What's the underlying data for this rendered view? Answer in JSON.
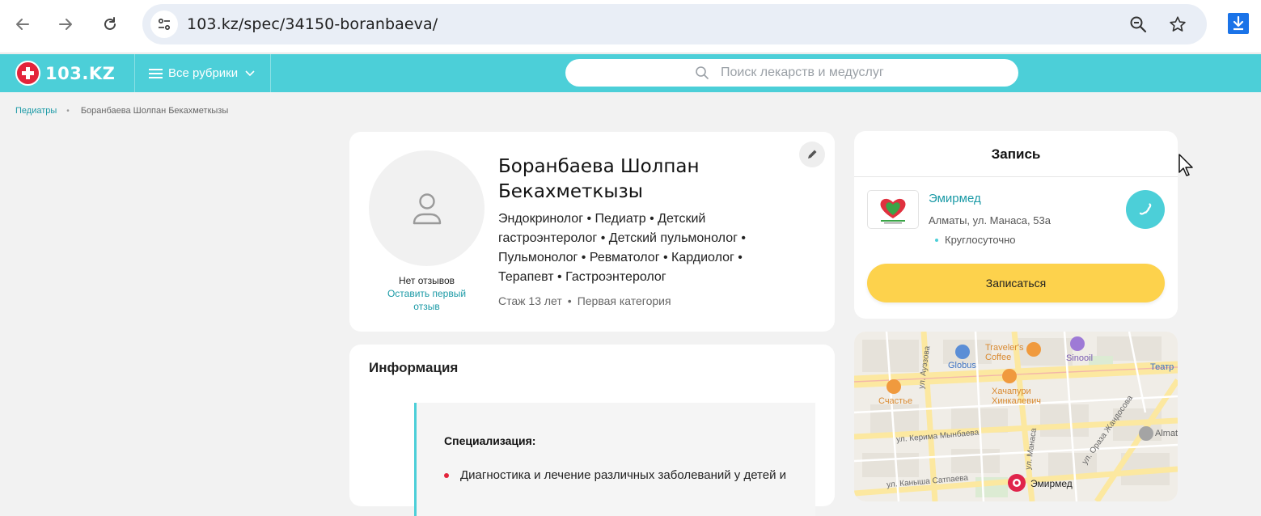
{
  "browser": {
    "url": "103.kz/spec/34150-boranbaeva/",
    "icons": [
      "back-arrow-icon",
      "forward-arrow-icon",
      "reload-icon",
      "site-settings-icon",
      "zoom-icon",
      "bookmark-star-icon",
      "download-icon"
    ]
  },
  "header": {
    "logo_text": "103.KZ",
    "rubrics_label": "Все рубрики",
    "search_placeholder": "Поиск лекарств и медуслуг",
    "brand_color": "#4ccfd8",
    "logo_color": "#e3243b"
  },
  "breadcrumb": {
    "items": [
      {
        "label": "Педиатры"
      },
      {
        "label": "Боранбаева Шолпан Бекахметкызы"
      }
    ],
    "separator": "•"
  },
  "profile": {
    "name": "Боранбаева Шолпан Бекахметкызы",
    "specialties": "Эндокринолог • Педиатр • Детский гастроэнтеролог • Детский пульмонолог • Пульмонолог • Ревматолог • Кардиолог • Терапевт • Гастроэнтеролог",
    "experience": "Стаж 13 лет",
    "category": "Первая категория",
    "no_reviews": "Нет отзывов",
    "leave_review": "Оставить первый отзыв"
  },
  "info": {
    "title": "Информация",
    "specialization_title": "Специализация:",
    "items": [
      "Диагностика и лечение различных заболеваний у детей и"
    ]
  },
  "booking": {
    "title": "Запись",
    "clinic_name": "Эмирмед",
    "clinic_address": "Алматы, ул. Манаса, 53а",
    "clinic_hours": "Круглосуточно",
    "book_button": "Записаться",
    "button_color": "#fdd24c"
  },
  "map": {
    "labels": {
      "travelers": "Traveler's\nCoffee",
      "sinooil": "Sinooil",
      "globus": "Globus",
      "teatr": "Театр",
      "khachapuri": "Хачапури\nХинкалевич",
      "schastie": "Счастье",
      "auezova": "ул. Ауэзова",
      "mynbaeva": "ул. Керима Мынбаева",
      "manasa": "ул. Манаса",
      "oraza": "ул. Ораза Жандосова",
      "kanysha": "ул. Каныша Сатпаева",
      "emirmed": "Эмирмед",
      "almat": "Almat"
    }
  }
}
